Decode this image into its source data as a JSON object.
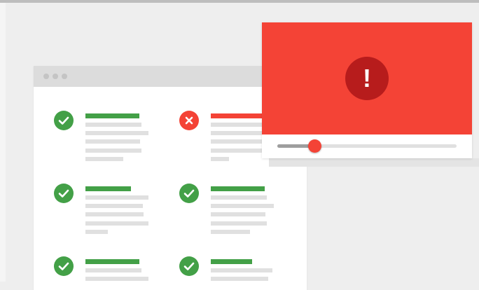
{
  "colors": {
    "background": "#eeeeee",
    "window_card": "#ffffff",
    "window_bar": "#dcdcdc",
    "pass_green": "#43a047",
    "fail_red": "#f44336",
    "placeholder_grey": "#e0e0e0",
    "player_screen_red": "#f44336",
    "alert_badge_dark_red": "#b71c1c",
    "alert_text": "#ffffff"
  },
  "browser_window": {
    "items": [
      {
        "status": "pass",
        "icon": "check-icon"
      },
      {
        "status": "fail",
        "icon": "close-icon"
      },
      {
        "status": "pass",
        "icon": "check-icon"
      },
      {
        "status": "pass",
        "icon": "check-icon"
      },
      {
        "status": "pass",
        "icon": "check-icon"
      },
      {
        "status": "pass",
        "icon": "check-icon"
      }
    ]
  },
  "video_player": {
    "alert_symbol": "!",
    "alert_icon": "exclamation-icon",
    "progress_fraction": 0.21
  }
}
